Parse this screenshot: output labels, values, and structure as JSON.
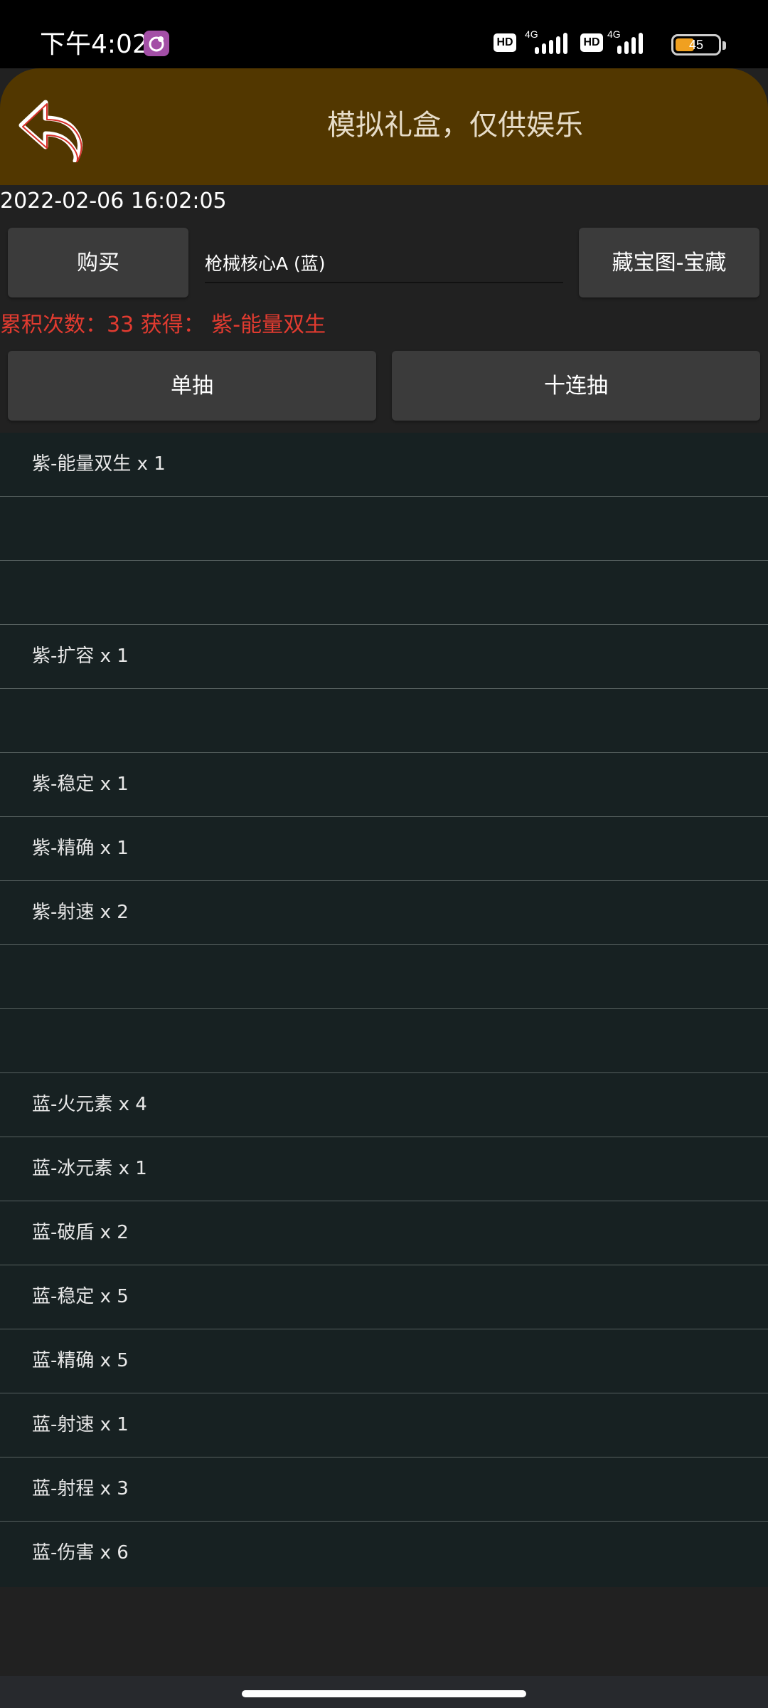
{
  "status_bar": {
    "time": "下午4:02",
    "hd_label": "HD",
    "network_label": "4G",
    "battery_level_percent": 45,
    "battery_text": "45",
    "app_icon": "game-app-icon"
  },
  "header": {
    "back_icon": "back-arrow-icon",
    "title": "模拟礼盒，仅供娱乐",
    "background_color": "#523700"
  },
  "timestamp": "2022-02-06 16:02:05",
  "controls": {
    "buy_label": "购买",
    "item_value": "枪械核心A (蓝)",
    "treasure_label": "藏宝图-宝藏",
    "single_draw_label": "单抽",
    "ten_draw_label": "十连抽"
  },
  "stats": {
    "text": "累积次数：33 获得：  紫-能量双生",
    "color": "#e13b30"
  },
  "results": [
    "紫-能量双生 x 1",
    "",
    "",
    "紫-扩容 x 1",
    "",
    "紫-稳定 x 1",
    "紫-精确 x 1",
    "紫-射速 x 2",
    "",
    "",
    "蓝-火元素 x 4",
    "蓝-冰元素 x 1",
    "蓝-破盾 x 2",
    "蓝-稳定 x 5",
    "蓝-精确 x 5",
    "蓝-射速 x 1",
    "蓝-射程 x 3",
    "蓝-伤害 x 6"
  ],
  "colors": {
    "list_background": "#172122",
    "button_background": "#3b3b3b",
    "page_background": "#212121"
  }
}
